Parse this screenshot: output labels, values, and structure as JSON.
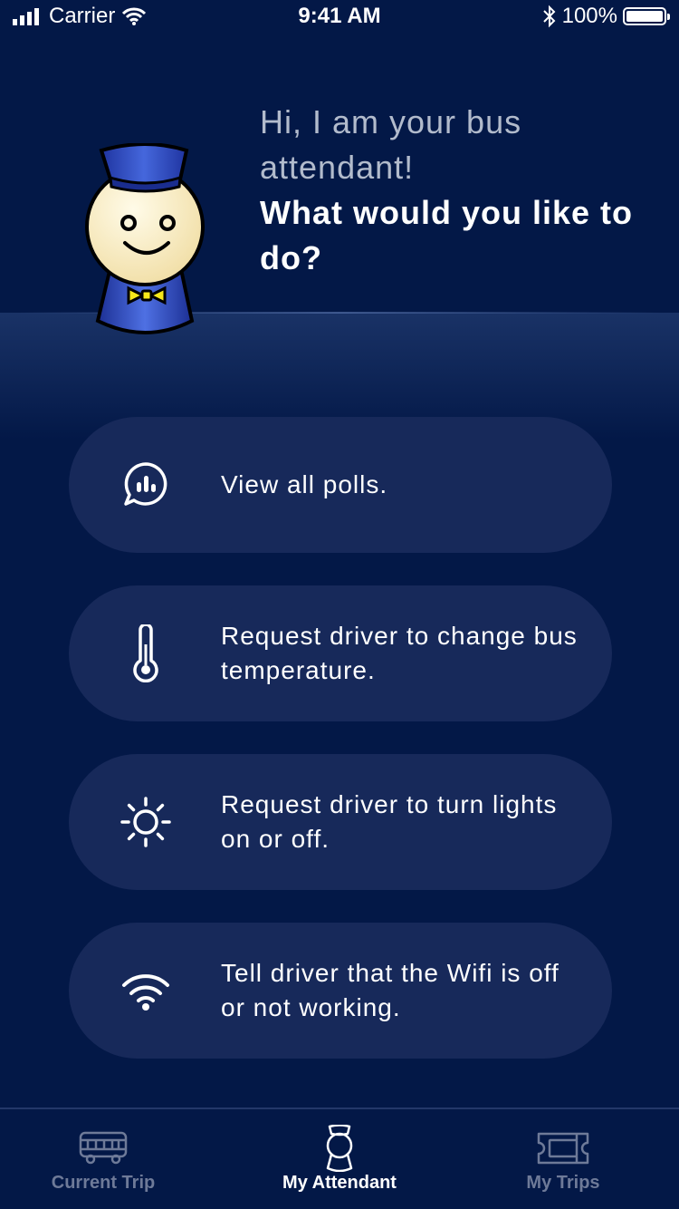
{
  "status_bar": {
    "carrier": "Carrier",
    "time": "9:41 AM",
    "battery_percent": "100%",
    "icons": [
      "signal-icon",
      "wifi-icon",
      "bluetooth-icon",
      "battery-icon"
    ]
  },
  "header": {
    "greeting_line1": "Hi, I am your bus attendant!",
    "greeting_line2": "What would you like to do?",
    "mascot": "bus-attendant-mascot"
  },
  "actions": [
    {
      "label": "View all polls.",
      "icon": "poll-chat-icon"
    },
    {
      "label": "Request driver to change bus temperature.",
      "icon": "thermometer-icon"
    },
    {
      "label": "Request driver to turn lights on or off.",
      "icon": "sun-icon"
    },
    {
      "label": "Tell driver that the Wifi is off or not working.",
      "icon": "wifi-icon"
    }
  ],
  "tab_bar": {
    "tabs": [
      {
        "label": "Current Trip",
        "icon": "bus-icon",
        "active": false
      },
      {
        "label": "My Attendant",
        "icon": "attendant-icon",
        "active": true
      },
      {
        "label": "My Trips",
        "icon": "ticket-icon",
        "active": false
      }
    ]
  },
  "colors": {
    "background": "#031847",
    "card": "#17295a",
    "greeting_muted": "#b2bbcc",
    "tab_inactive": "#6e7a98",
    "tab_active": "#ffffff"
  }
}
